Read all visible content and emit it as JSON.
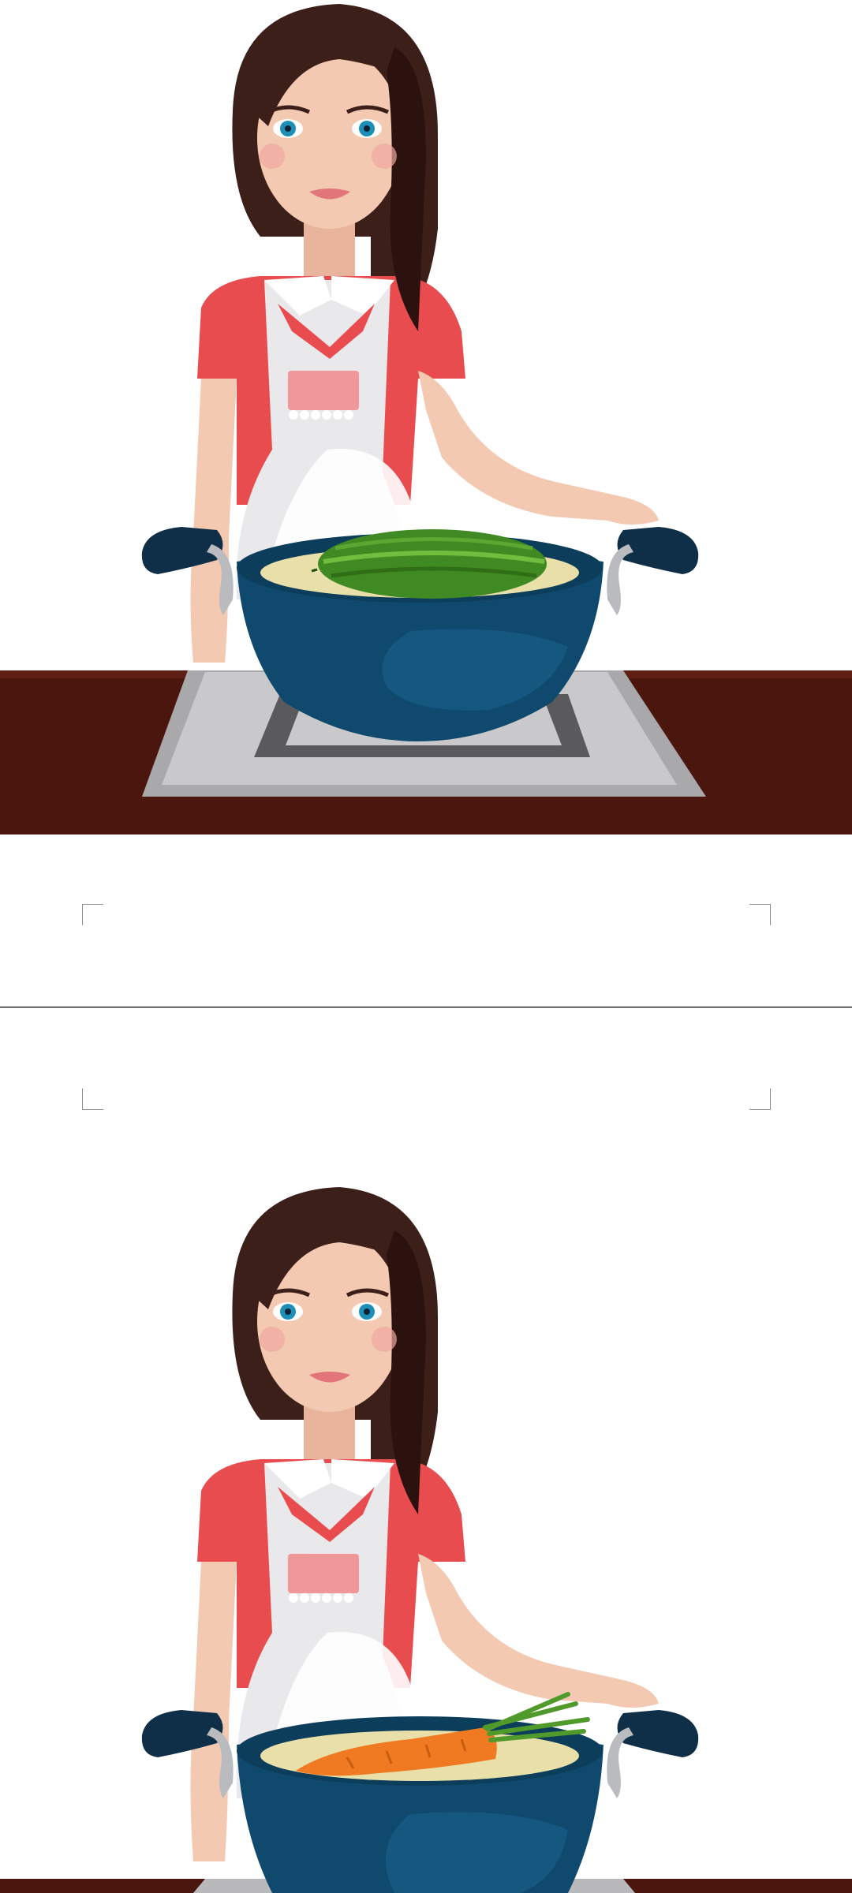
{
  "document": {
    "pages": [
      {
        "illustration": "woman-cooking-cucumber",
        "vegetable": "cucumber"
      },
      {
        "illustration": "woman-cooking-carrot",
        "vegetable": "carrot"
      }
    ],
    "colors": {
      "hair": "#3d1f1a",
      "skin": "#f3c9b1",
      "shirt": "#e84c4f",
      "apron": "#e9e9ec",
      "pot": "#0f4a6e",
      "counter": "#4a160e",
      "stove": "#b9b9bb",
      "cucumber": "#4b9a2a",
      "carrot": "#f07a22"
    }
  }
}
